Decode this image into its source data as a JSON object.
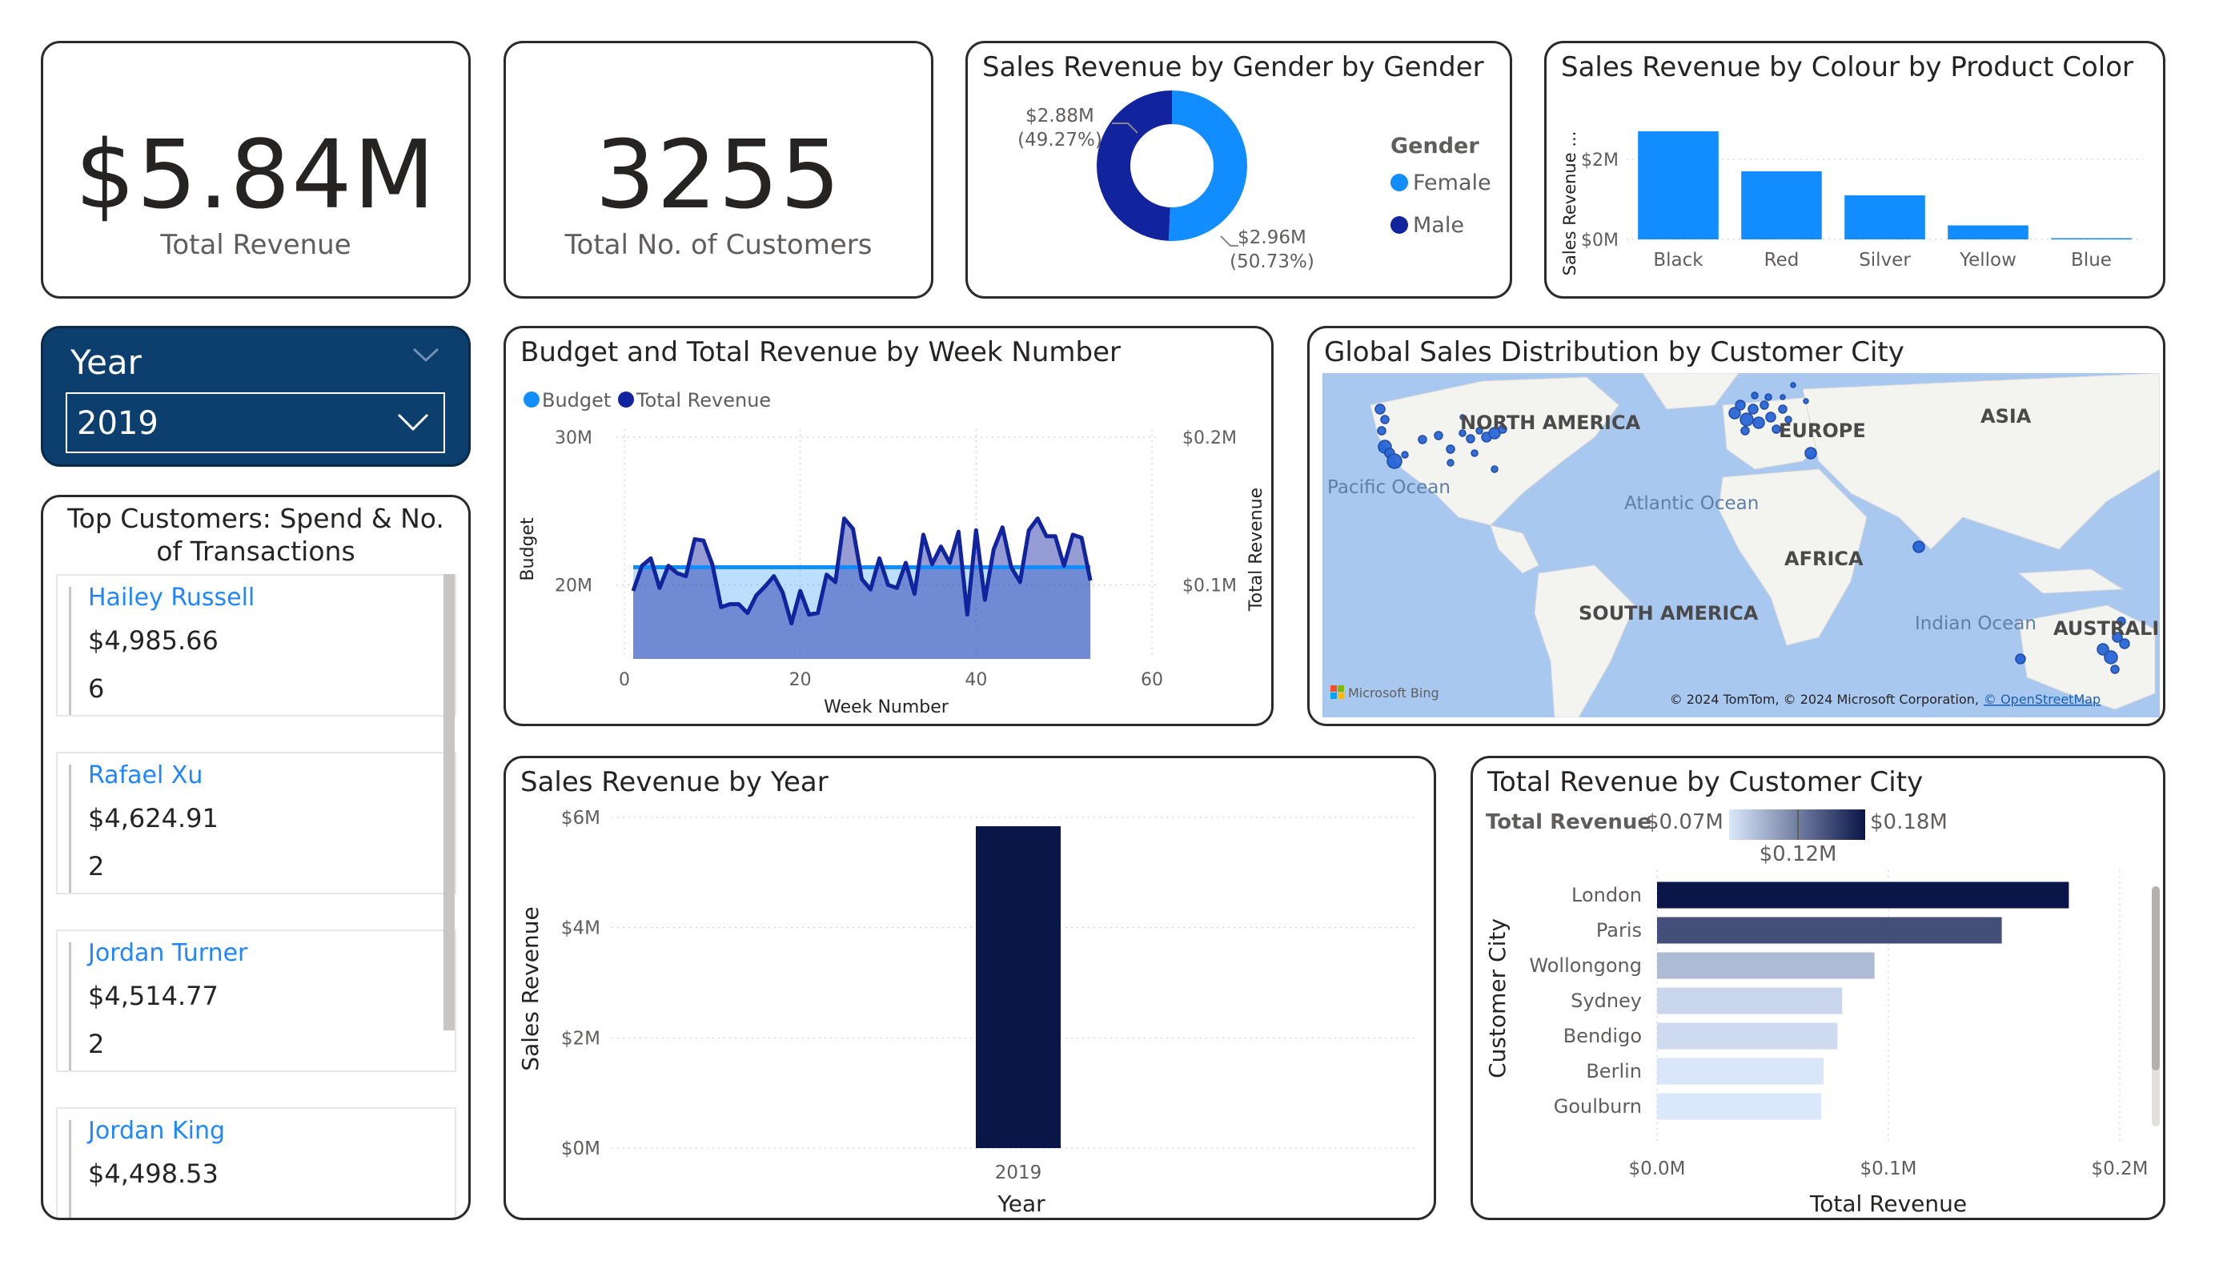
{
  "colors": {
    "light_blue": "#118dff",
    "navy": "#12239e",
    "dark_navy": "#0a1548",
    "slicer_bg": "#0c3e6e",
    "link_blue": "#1f86ff",
    "map_water": "#a9c8f0",
    "map_land": "#f2f2f2"
  },
  "kpis": {
    "total_revenue": {
      "value": "$5.84M",
      "label": "Total Revenue"
    },
    "total_customers": {
      "value": "3255",
      "label": "Total No. of Customers"
    }
  },
  "slicer": {
    "title": "Year",
    "selected": "2019",
    "icon": "chevron-down-icon"
  },
  "top_customers": {
    "title": "Top Customers: Spend & No. of Transactions",
    "items": [
      {
        "name": "Hailey Russell",
        "spend": "$4,985.66",
        "transactions": "6"
      },
      {
        "name": "Rafael Xu",
        "spend": "$4,624.91",
        "transactions": "2"
      },
      {
        "name": "Jordan Turner",
        "spend": "$4,514.77",
        "transactions": "2"
      },
      {
        "name": "Jordan King",
        "spend": "$4,498.53",
        "transactions": ""
      }
    ]
  },
  "gender_chart": {
    "title": "Sales Revenue by Gender by Gender",
    "legend_title": "Gender",
    "labels": {
      "male_value": "$2.88M",
      "male_pct": "(49.27%)",
      "female_value": "$2.96M",
      "female_pct": "(50.73%)"
    }
  },
  "colour_chart": {
    "title": "Sales Revenue by Colour by Product Color",
    "ylabel": "Sales Revenue ...",
    "ytick_labels": [
      "$0M",
      "$2M"
    ]
  },
  "week_chart": {
    "title": "Budget and Total Revenue by Week Number",
    "legend": [
      "Budget",
      "Total Revenue"
    ],
    "xlabel": "Week Number",
    "ylabel_left": "Budget",
    "ylabel_right": "Total Revenue",
    "xticks": [
      "0",
      "20",
      "40",
      "60"
    ],
    "yticks_left": [
      "20M",
      "30M"
    ],
    "yticks_right": [
      "$0.1M",
      "$0.2M"
    ]
  },
  "map": {
    "title": "Global Sales Distribution by Customer City",
    "labels": {
      "north_america": "NORTH AMERICA",
      "europe": "EUROPE",
      "asia": "ASIA",
      "africa": "AFRICA",
      "south_america": "SOUTH AMERICA",
      "australia": "AUSTRALIA",
      "pacific": "Pacific Ocean",
      "atlantic": "Atlantic Ocean",
      "indian": "Indian Ocean"
    },
    "brand": "Microsoft Bing",
    "attribution": "© 2024 TomTom, © 2024 Microsoft Corporation,",
    "attribution_link": "© OpenStreetMap"
  },
  "year_chart": {
    "title": "Sales Revenue by Year",
    "xlabel": "Year",
    "ylabel": "Sales Revenue",
    "ytick_labels": [
      "$0M",
      "$2M",
      "$4M",
      "$6M"
    ]
  },
  "city_chart": {
    "title": "Total Revenue by Customer City",
    "legend_label": "Total Revenue",
    "legend_min": "$0.07M",
    "legend_mid": "$0.12M",
    "legend_max": "$0.18M",
    "xlabel": "Total Revenue",
    "ylabel": "Customer City",
    "xtick_labels": [
      "$0.0M",
      "$0.1M",
      "$0.2M"
    ]
  },
  "chart_data": [
    {
      "type": "pie",
      "title": "Sales Revenue by Gender by Gender",
      "categories": [
        "Female",
        "Male"
      ],
      "values": [
        2.96,
        2.88
      ],
      "percent": [
        50.73,
        49.27
      ],
      "unit": "$M",
      "colors": [
        "#118dff",
        "#12239e"
      ],
      "donut": true,
      "legend_placement": "right"
    },
    {
      "type": "bar",
      "title": "Sales Revenue by Colour by Product Color",
      "categories": [
        "Black",
        "Red",
        "Silver",
        "Yellow",
        "Blue"
      ],
      "values": [
        2.7,
        1.7,
        1.1,
        0.35,
        0.03
      ],
      "unit": "$M",
      "ylim": [
        0,
        3
      ],
      "grid": true
    },
    {
      "type": "line",
      "title": "Budget and Total Revenue by Week Number",
      "x": [
        1,
        2,
        3,
        4,
        5,
        6,
        7,
        8,
        9,
        10,
        11,
        12,
        13,
        14,
        15,
        16,
        17,
        18,
        19,
        20,
        21,
        22,
        23,
        24,
        25,
        26,
        27,
        28,
        29,
        30,
        31,
        32,
        33,
        34,
        35,
        36,
        37,
        38,
        39,
        40,
        41,
        42,
        43,
        44,
        45,
        46,
        47,
        48,
        49,
        50,
        51,
        52,
        53
      ],
      "series": [
        {
          "name": "Budget",
          "axis": "left",
          "unit": "M",
          "values": [
            21.2,
            21.2,
            21.2,
            21.2,
            21.2,
            21.2,
            21.2,
            21.2,
            21.2,
            21.2,
            21.2,
            21.2,
            21.2,
            21.2,
            21.2,
            21.2,
            21.2,
            21.2,
            21.2,
            21.2,
            21.2,
            21.2,
            21.2,
            21.2,
            21.2,
            21.2,
            21.2,
            21.2,
            21.2,
            21.2,
            21.2,
            21.2,
            21.2,
            21.2,
            21.2,
            21.2,
            21.2,
            21.2,
            21.2,
            21.2,
            21.2,
            21.2,
            21.2,
            21.2,
            21.2,
            21.2,
            21.2,
            21.2,
            21.2,
            21.2,
            21.2,
            21.2,
            21.2
          ]
        },
        {
          "name": "Total Revenue",
          "axis": "right",
          "unit": "$M",
          "values": [
            0.096,
            0.113,
            0.118,
            0.098,
            0.113,
            0.108,
            0.106,
            0.131,
            0.13,
            0.114,
            0.085,
            0.087,
            0.087,
            0.081,
            0.093,
            0.099,
            0.106,
            0.095,
            0.074,
            0.096,
            0.08,
            0.081,
            0.107,
            0.102,
            0.145,
            0.138,
            0.104,
            0.097,
            0.118,
            0.1,
            0.098,
            0.115,
            0.094,
            0.134,
            0.114,
            0.126,
            0.115,
            0.136,
            0.08,
            0.137,
            0.09,
            0.124,
            0.139,
            0.112,
            0.102,
            0.137,
            0.145,
            0.133,
            0.133,
            0.113,
            0.134,
            0.132,
            0.103
          ]
        }
      ],
      "xlim": [
        0,
        60
      ],
      "ylim_left": [
        15,
        30
      ],
      "ylim_right": [
        0.05,
        0.2
      ],
      "xlabel": "Week Number",
      "legend_placement": "top-left",
      "grid": true
    },
    {
      "type": "bar",
      "title": "Sales Revenue by Year",
      "categories": [
        "2019"
      ],
      "values": [
        5.84
      ],
      "unit": "$M",
      "ylim": [
        0,
        6
      ],
      "xlabel": "Year",
      "ylabel": "Sales Revenue",
      "grid": true
    },
    {
      "type": "bar",
      "orientation": "horizontal",
      "title": "Total Revenue by Customer City",
      "categories": [
        "London",
        "Paris",
        "Wollongong",
        "Sydney",
        "Bendigo",
        "Berlin",
        "Goulburn"
      ],
      "values": [
        0.178,
        0.149,
        0.094,
        0.08,
        0.078,
        0.072,
        0.071
      ],
      "unit": "$M",
      "xlim": [
        0,
        0.2
      ],
      "xlabel": "Total Revenue",
      "ylabel": "Customer City",
      "color_scale": [
        "#dbe8fb",
        "#0a1548"
      ],
      "grid": true
    }
  ]
}
